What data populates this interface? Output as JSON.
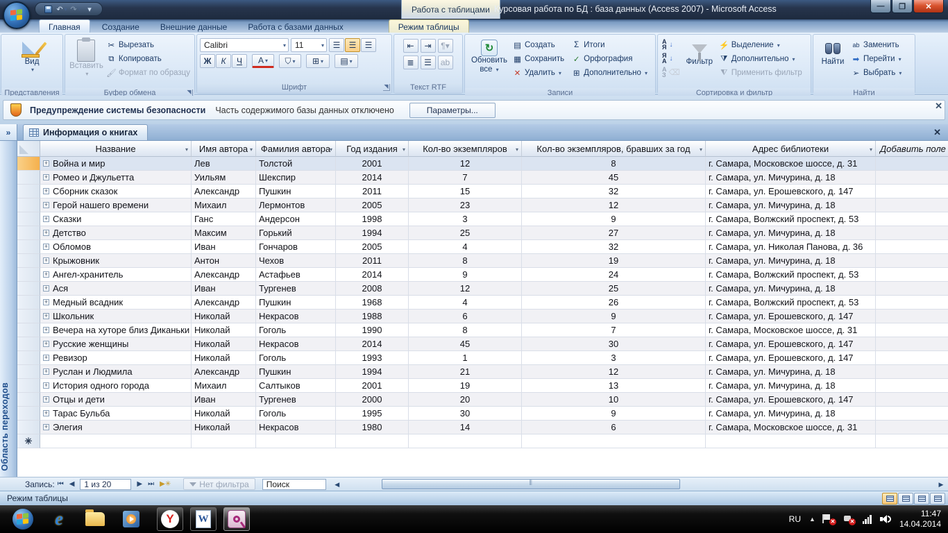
{
  "titlebar": {
    "context_group": "Работа с таблицами",
    "title": "Курсовая работа по БД : база данных (Access 2007)  -  Microsoft Access"
  },
  "ribbon_tabs": [
    {
      "label": "Главная"
    },
    {
      "label": "Создание"
    },
    {
      "label": "Внешние данные"
    },
    {
      "label": "Работа с базами данных"
    },
    {
      "label": "Режим таблицы"
    }
  ],
  "ribbon": {
    "views": {
      "button": "Вид",
      "group": "Представления"
    },
    "clipboard": {
      "paste": "Вставить",
      "cut": "Вырезать",
      "copy": "Копировать",
      "format_painter": "Формат по образцу",
      "group": "Буфер обмена"
    },
    "font": {
      "family": "Calibri",
      "size": "11",
      "bold": "Ж",
      "italic": "К",
      "underline": "Ч",
      "color": "А",
      "group": "Шрифт"
    },
    "rtf": {
      "group": "Текст RTF"
    },
    "records": {
      "refresh_line1": "Обновить",
      "refresh_line2": "все",
      "create": "Создать",
      "save": "Сохранить",
      "delete": "Удалить",
      "totals": "Итоги",
      "spelling": "Орфография",
      "more": "Дополнительно",
      "group": "Записи"
    },
    "sortfilter": {
      "filter": "Фильтр",
      "selection": "Выделение",
      "advanced": "Дополнительно",
      "apply": "Применить фильтр",
      "sort_az": "АЯ",
      "sort_za": "ЯА",
      "sort_clear": "АЗ",
      "group": "Сортировка и фильтр"
    },
    "find": {
      "find": "Найти",
      "replace": "Заменить",
      "goto": "Перейти",
      "select": "Выбрать",
      "group": "Найти"
    }
  },
  "security_bar": {
    "warning": "Предупреждение системы безопасности",
    "message": "Часть содержимого базы данных отключено",
    "options_button": "Параметры..."
  },
  "nav_pane": {
    "expand_glyph": "»",
    "title": "Область переходов"
  },
  "document": {
    "tab": "Информация о книгах",
    "columns": [
      "Название",
      "Имя автора",
      "Фамилия автора",
      "Год издания",
      "Кол-во экземпляров",
      "Кол-во экземпляров, бравших за год",
      "Адрес библиотеки"
    ],
    "add_column": "Добавить поле",
    "rows": [
      [
        "Война и мир",
        "Лев",
        "Толстой",
        "2001",
        "12",
        "8",
        "г. Самара, Московское шоссе, д. 31"
      ],
      [
        "Ромео и Джульетта",
        "Уильям",
        "Шекспир",
        "2014",
        "7",
        "45",
        "г. Самара, ул. Мичурина, д. 18"
      ],
      [
        "Сборник сказок",
        "Александр",
        "Пушкин",
        "2011",
        "15",
        "32",
        "г. Самара, ул. Ерошевского, д. 147"
      ],
      [
        "Герой нашего времени",
        "Михаил",
        "Лермонтов",
        "2005",
        "23",
        "12",
        "г. Самара, ул. Мичурина, д. 18"
      ],
      [
        "Сказки",
        "Ганс",
        "Андерсон",
        "1998",
        "3",
        "9",
        "г. Самара, Волжский проспект, д. 53"
      ],
      [
        "Детство",
        "Максим",
        "Горький",
        "1994",
        "25",
        "27",
        "г. Самара, ул. Мичурина, д. 18"
      ],
      [
        "Обломов",
        "Иван",
        "Гончаров",
        "2005",
        "4",
        "32",
        "г. Самара, ул. Николая Панова, д. 36"
      ],
      [
        "Крыжовник",
        "Антон",
        "Чехов",
        "2011",
        "8",
        "19",
        "г. Самара, ул. Мичурина, д. 18"
      ],
      [
        "Ангел-хранитель",
        "Александр",
        "Астафьев",
        "2014",
        "9",
        "24",
        "г. Самара, Волжский проспект, д. 53"
      ],
      [
        "Ася",
        "Иван",
        "Тургенев",
        "2008",
        "12",
        "25",
        "г. Самара, ул. Мичурина, д. 18"
      ],
      [
        "Медный всадник",
        "Александр",
        "Пушкин",
        "1968",
        "4",
        "26",
        "г. Самара, Волжский проспект, д. 53"
      ],
      [
        "Школьник",
        "Николай",
        "Некрасов",
        "1988",
        "6",
        "9",
        "г. Самара, ул. Ерошевского, д. 147"
      ],
      [
        "Вечера на хуторе близ Диканьки",
        "Николай",
        "Гоголь",
        "1990",
        "8",
        "7",
        "г. Самара, Московское шоссе, д. 31"
      ],
      [
        "Русские женщины",
        "Николай",
        "Некрасов",
        "2014",
        "45",
        "30",
        "г. Самара, ул. Ерошевского, д. 147"
      ],
      [
        "Ревизор",
        "Николай",
        "Гоголь",
        "1993",
        "1",
        "3",
        "г. Самара, ул. Ерошевского, д. 147"
      ],
      [
        "Руслан и Людмила",
        "Александр",
        "Пушкин",
        "1994",
        "21",
        "12",
        "г. Самара, ул. Мичурина, д. 18"
      ],
      [
        "История одного города",
        "Михаил",
        "Салтыков",
        "2001",
        "19",
        "13",
        "г. Самара, ул. Мичурина, д. 18"
      ],
      [
        "Отцы и дети",
        "Иван",
        "Тургенев",
        "2000",
        "20",
        "10",
        "г. Самара, ул. Ерошевского, д. 147"
      ],
      [
        "Тарас Бульба",
        "Николай",
        "Гоголь",
        "1995",
        "30",
        "9",
        "г. Самара, ул. Мичурина, д. 18"
      ],
      [
        "Элегия",
        "Николай",
        "Некрасов",
        "1980",
        "14",
        "6",
        "г. Самара, Московское шоссе, д. 31"
      ]
    ]
  },
  "record_nav": {
    "label": "Запись:",
    "position": "1 из 20",
    "no_filter": "Нет фильтра",
    "search_value": "Поиск"
  },
  "status_bar": {
    "mode": "Режим таблицы"
  },
  "taskbar": {
    "lang": "RU",
    "time": "11:47",
    "date": "14.04.2014"
  },
  "colors": {
    "ribbon_bg": "#d3e3f5",
    "selection_row": "#dbe4f1",
    "row_selector_current": "#f5b04c",
    "taskbar": "#000000",
    "title_bar": "#27354d"
  }
}
